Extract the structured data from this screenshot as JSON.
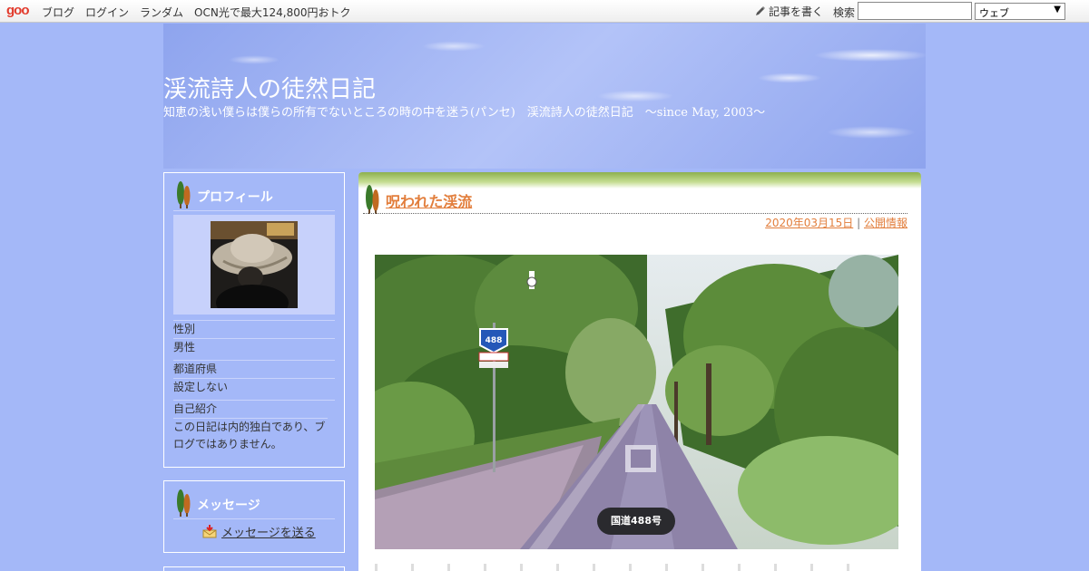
{
  "topbar": {
    "logo": "goo",
    "nav": [
      "ブログ",
      "ログイン",
      "ランダム",
      "OCN光で最大124,800円おトク"
    ],
    "write_label": "記事を書く",
    "search_label": "検索",
    "search_value": "",
    "search_scope": "ウェブ"
  },
  "header": {
    "title": "渓流詩人の徒然日記",
    "description": "知恵の浅い僕らは僕らの所有でないところの時の中を迷う(パンセ)　渓流詩人の徒然日記　～since May, 2003～"
  },
  "sidebar": {
    "profile": {
      "title": "プロフィール",
      "rows": [
        {
          "label": "性別",
          "value": "男性"
        },
        {
          "label": "都道府県",
          "value": "設定しない"
        },
        {
          "label": "自己紹介",
          "value": "この日記は内的独白であり、ブログではありません。"
        }
      ]
    },
    "message": {
      "title": "メッセージ",
      "link": "メッセージを送る"
    }
  },
  "post": {
    "title": "呪われた渓流",
    "date": "2020年03月15日",
    "separator": "|",
    "category": "公開情報",
    "photo_sign": "488",
    "photo_road_label": "国道488号"
  },
  "colors": {
    "background": "#a4b8f8",
    "accent": "#e27e3c",
    "band": "#8db04e"
  }
}
